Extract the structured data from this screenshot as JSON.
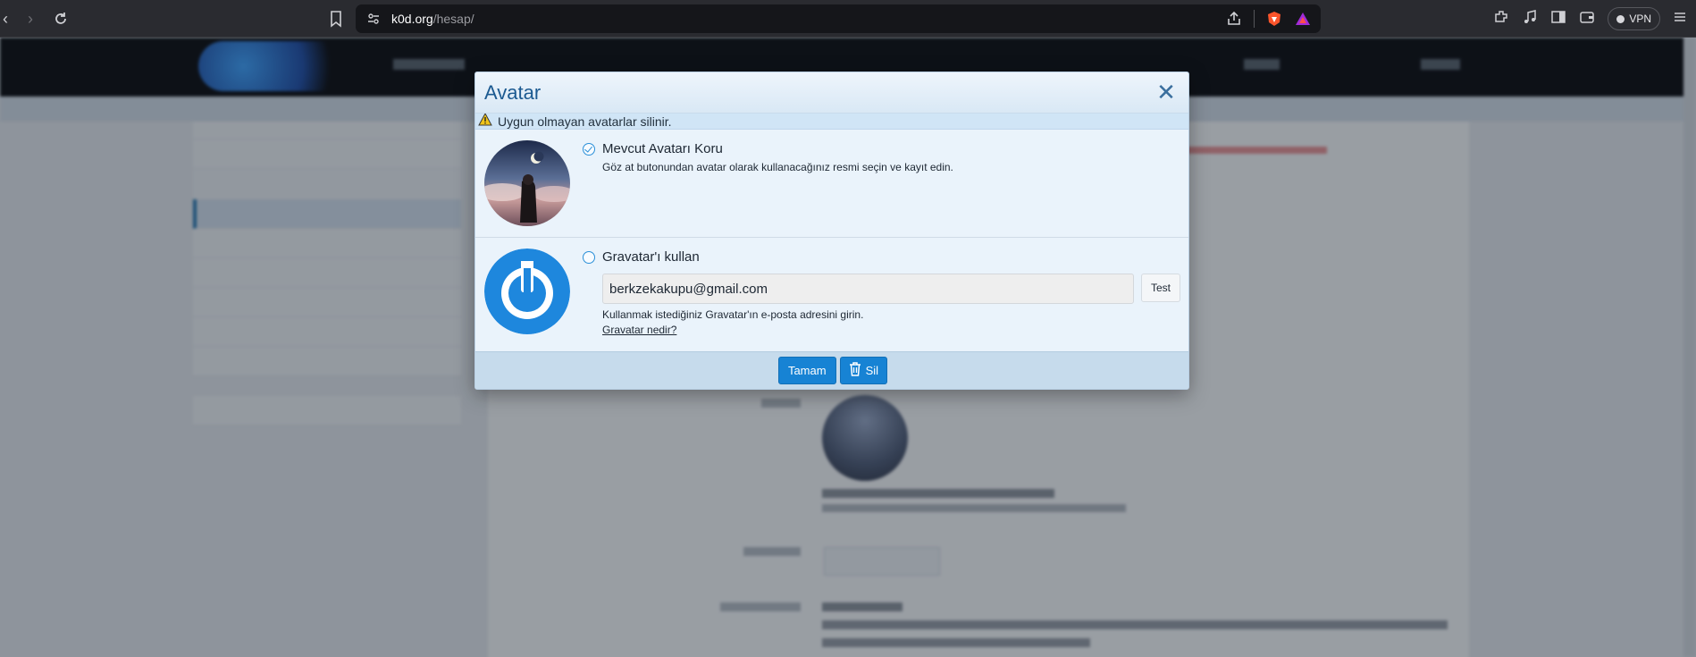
{
  "browser": {
    "url_domain": "k0d.org",
    "url_path": "/hesap/",
    "vpn_label": "VPN",
    "icons": [
      "back-icon",
      "forward-icon",
      "reload-icon",
      "bookmark-icon",
      "site-info-icon",
      "share-icon",
      "brave-shields-icon",
      "brave-rewards-icon",
      "extensions-icon",
      "media-icon",
      "sidebar-icon",
      "wallet-icon",
      "menu-icon"
    ]
  },
  "dialog": {
    "title": "Avatar",
    "close_icon": "close-icon",
    "warning_text": "Uygun olmayan avatarlar silinir.",
    "option_keep": {
      "title": "Mevcut Avatarı Koru",
      "description": "Göz at butonundan avatar olarak kullanacağınız resmi seçin ve kayıt edin.",
      "checked": true
    },
    "option_gravatar": {
      "title": "Gravatar'ı kullan",
      "email_value": "berkzekakupu@gmail.com",
      "test_label": "Test",
      "help_text": "Kullanmak istediğiniz Gravatar'ın e-posta adresini girin.",
      "link_text": "Gravatar nedir?",
      "checked": false
    },
    "ok_label": "Tamam",
    "delete_label": "Sil"
  },
  "colors": {
    "accent": "#1783d4",
    "title": "#1c5a91",
    "warning": "#f0c419",
    "gravatar_blue": "#1e87dd"
  }
}
